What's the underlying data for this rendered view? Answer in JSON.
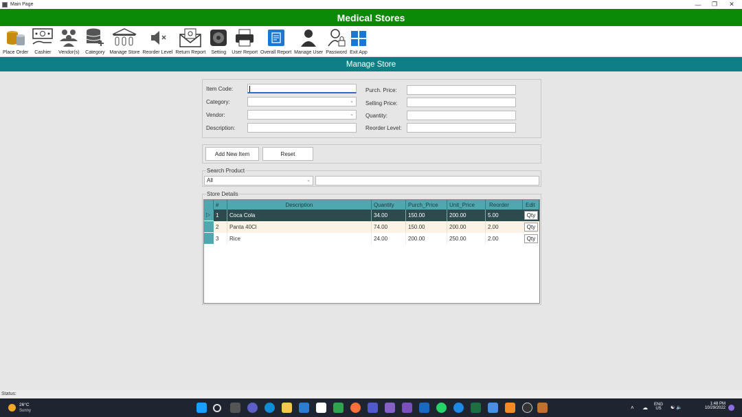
{
  "window": {
    "title": "Main Page",
    "minimize": "—",
    "maximize": "❐",
    "close": "✕"
  },
  "app": {
    "title": "Medical Stores",
    "section_title": "Manage Store"
  },
  "toolbar": {
    "items": [
      {
        "label": "Place Order",
        "icon": "coins-stack-icon"
      },
      {
        "label": "Cashier",
        "icon": "cash-icon"
      },
      {
        "label": "Vendor(s)",
        "icon": "users-group-icon"
      },
      {
        "label": "Category",
        "icon": "database-add-icon"
      },
      {
        "label": "Manage Store",
        "icon": "bank-icon"
      },
      {
        "label": "Reorder Level",
        "icon": "speaker-mute-icon"
      },
      {
        "label": "Return Report",
        "icon": "envelope-icon"
      },
      {
        "label": "Setting",
        "icon": "gear-icon"
      },
      {
        "label": "User Report",
        "icon": "printer-icon"
      },
      {
        "label": "Overall Report",
        "icon": "report-icon"
      },
      {
        "label": "Manage User",
        "icon": "user-icon"
      },
      {
        "label": "Password",
        "icon": "user-lock-icon"
      },
      {
        "label": "Exit App",
        "icon": "windows-icon"
      }
    ]
  },
  "form": {
    "item_code_label": "Item Code:",
    "category_label": "Category:",
    "vendor_label": "Vendor:",
    "description_label": "Description:",
    "purch_price_label": "Purch. Price:",
    "selling_price_label": "Selling Price:",
    "quantity_label": "Quantity:",
    "reorder_level_label": "Reorder Level:",
    "item_code": "",
    "category": "",
    "vendor": "",
    "description": "",
    "purch_price": "",
    "selling_price": "",
    "quantity": "",
    "reorder_level": ""
  },
  "actions": {
    "add_label": "Add New Item",
    "reset_label": "Reset"
  },
  "search": {
    "group_label": "Search Product",
    "filter_value": "All",
    "query": ""
  },
  "store": {
    "group_label": "Store Details",
    "columns": [
      "#",
      "Description",
      "Quantity",
      "Purch_Price",
      "Unit_Price",
      "Reorder",
      "Edit"
    ],
    "rows": [
      {
        "num": "1",
        "description": "Coca Cola",
        "quantity": "34.00",
        "purch_price": "150.00",
        "unit_price": "200.00",
        "reorder": "5.00",
        "edit": "Qty"
      },
      {
        "num": "2",
        "description": "Panta 40Cl",
        "quantity": "74.00",
        "purch_price": "150.00",
        "unit_price": "200.00",
        "reorder": "2.00",
        "edit": "Qty"
      },
      {
        "num": "3",
        "description": "Rice",
        "quantity": "24.00",
        "purch_price": "200.00",
        "unit_price": "250.00",
        "reorder": "2.00",
        "edit": "Qty"
      }
    ],
    "selected_row": 1
  },
  "status": {
    "label": "Status:"
  },
  "taskbar": {
    "weather_temp": "26°C",
    "weather_cond": "Sunny",
    "lang_line1": "ENG",
    "lang_line2": "US",
    "time": "1:48 PM",
    "date": "10/29/2022"
  },
  "colors": {
    "banner": "#0a8a07",
    "section": "#0e7f84",
    "grid_header": "#4fa8b0",
    "selected_row": "#2d4a4c"
  }
}
